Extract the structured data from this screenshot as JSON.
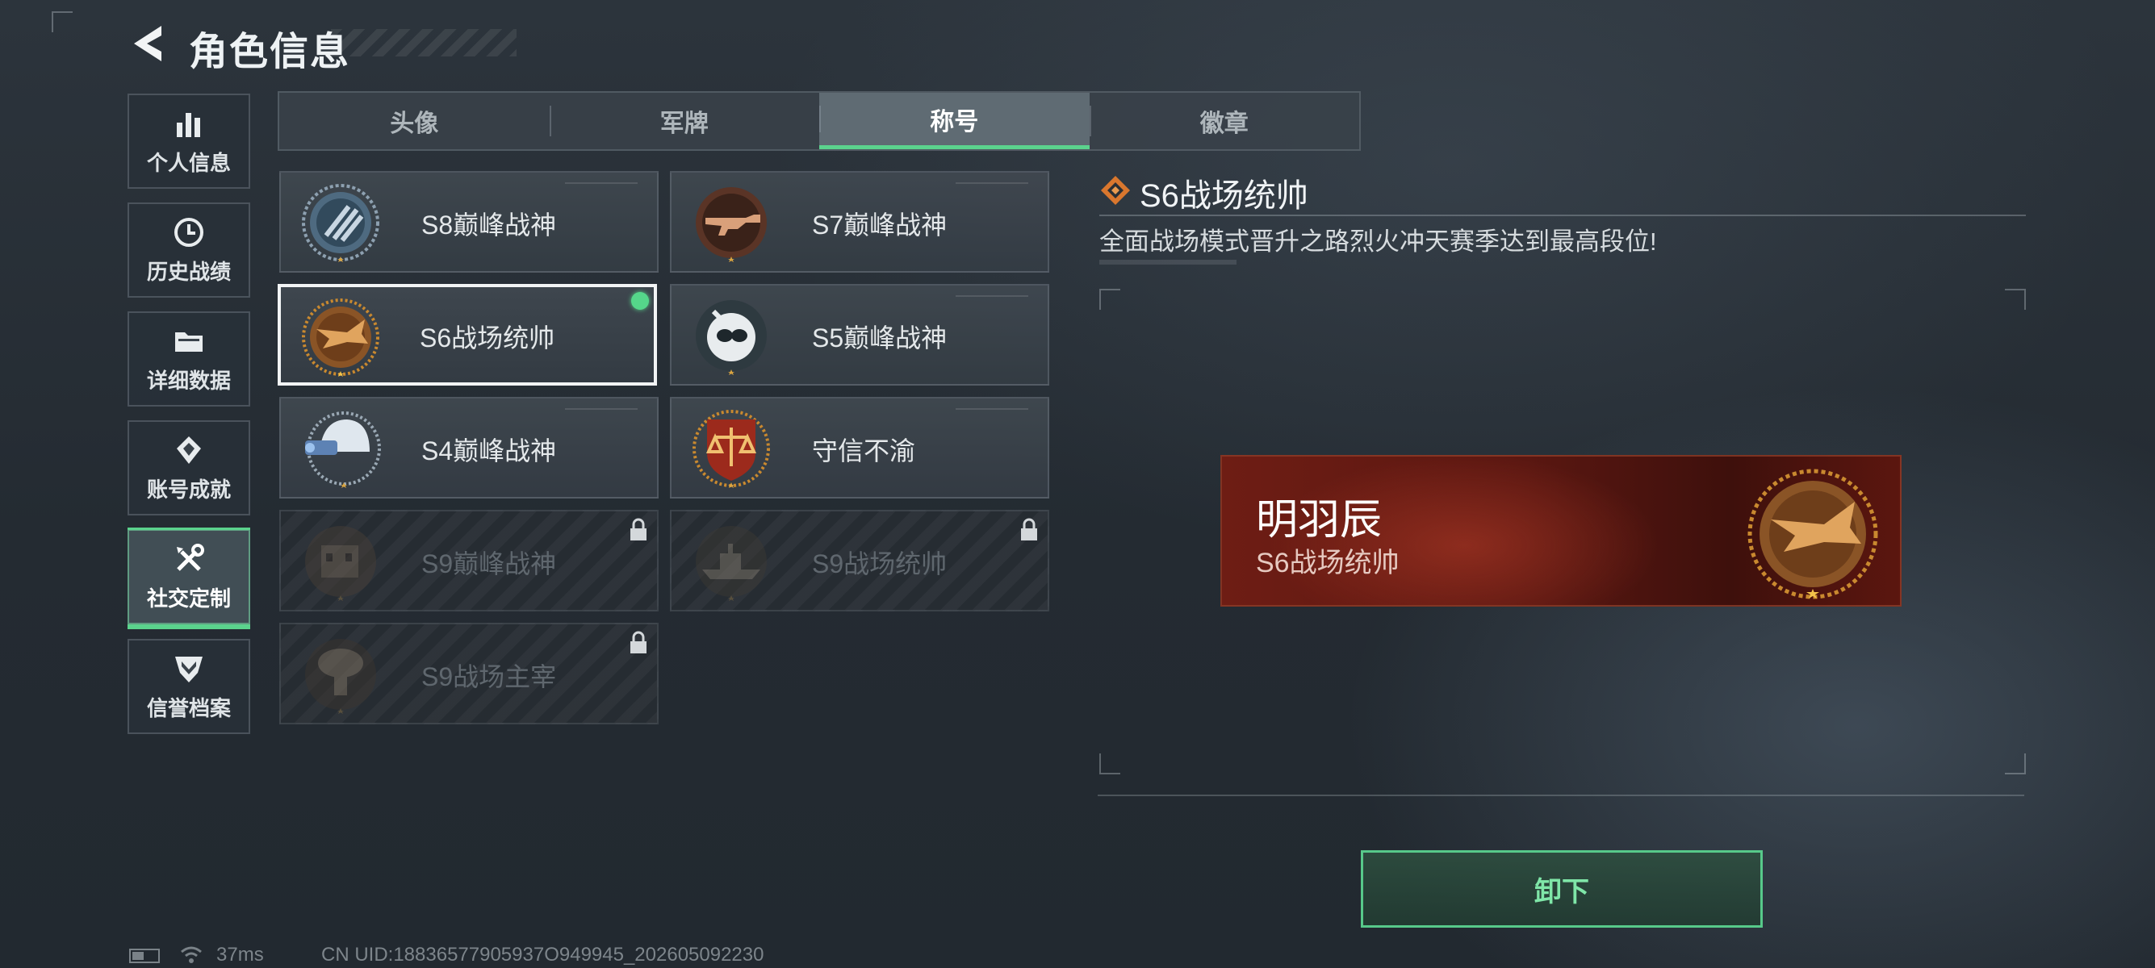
{
  "header": {
    "title": "角色信息"
  },
  "sidebar": {
    "items": [
      {
        "label": "个人信息",
        "icon": "bar-chart-icon"
      },
      {
        "label": "历史战绩",
        "icon": "clock-history-icon"
      },
      {
        "label": "详细数据",
        "icon": "folder-icon"
      },
      {
        "label": "账号成就",
        "icon": "achievement-icon"
      },
      {
        "label": "社交定制",
        "icon": "tools-icon",
        "active": true
      },
      {
        "label": "信誉档案",
        "icon": "shield-chevron-icon"
      }
    ]
  },
  "tabs": [
    {
      "label": "头像"
    },
    {
      "label": "军牌"
    },
    {
      "label": "称号",
      "active": true
    },
    {
      "label": "徽章"
    }
  ],
  "titles": [
    {
      "name": "S8巅峰战神",
      "medal": "emblem-stripes-medal",
      "locked": false
    },
    {
      "name": "S7巅峰战神",
      "medal": "rifle-medal",
      "locked": false
    },
    {
      "name": "S6战场统帅",
      "medal": "jet-medal",
      "locked": false,
      "selected": true,
      "equipped": true
    },
    {
      "name": "S5巅峰战神",
      "medal": "diver-helmet-medal",
      "locked": false
    },
    {
      "name": "S4巅峰战神",
      "medal": "helmet-medal",
      "locked": false
    },
    {
      "name": "守信不渝",
      "medal": "scales-shield-medal",
      "locked": false
    },
    {
      "name": "S9巅峰战神",
      "medal": "fortress-medal",
      "locked": true
    },
    {
      "name": "S9战场统帅",
      "medal": "warship-medal",
      "locked": true
    },
    {
      "name": "S9战场主宰",
      "medal": "mushroom-cloud-medal",
      "locked": true
    }
  ],
  "detail": {
    "title": "S6战场统帅",
    "description": "全面战场模式晋升之路烈火冲天赛季达到最高段位!"
  },
  "preview": {
    "player_name": "明羽辰",
    "title": "S6战场统帅"
  },
  "actions": {
    "unequip_label": "卸下"
  },
  "status": {
    "ping": "37ms",
    "uid": "CN UID:18836577905937O949945_202605092230"
  },
  "colors": {
    "accent": "#5bd38d",
    "banner": "#6e1d14",
    "medal_gold": "#c9892f"
  }
}
